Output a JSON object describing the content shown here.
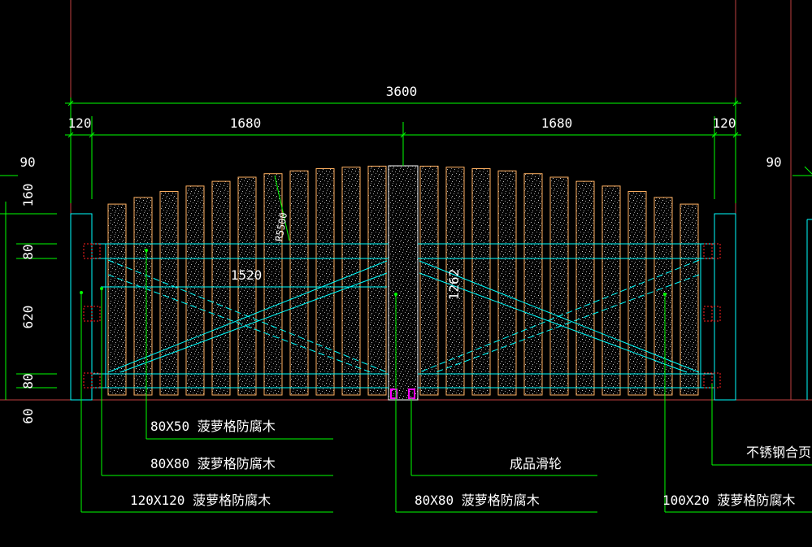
{
  "dimensions": {
    "overall": "3600",
    "left_post": "120",
    "left_leaf": "1680",
    "right_leaf": "1680",
    "right_post": "120",
    "left_offset": "90",
    "right_offset": "90",
    "h_top_arch": "160",
    "h_rail_top": "80",
    "h_middle": "620",
    "h_rail_bottom": "80",
    "h_ground": "60",
    "diag_width": "1520",
    "diag_height": "1262",
    "radius": "R5500"
  },
  "labels": {
    "board_80x50": "80X50 菠萝格防腐木",
    "board_80x80_left": "80X80 菠萝格防腐木",
    "post_120x120": "120X120 菠萝格防腐木",
    "wheel": "成品滑轮",
    "board_80x80_center": "80X80 菠萝格防腐木",
    "hinge": "不锈钢合页",
    "slat_100x20": "100X20 菠萝格防腐木"
  },
  "colors": {
    "background": "#000000",
    "dimension_line": "#00ff00",
    "frame_line": "#00ffff",
    "slat_edge": "#ffb060",
    "speckle": "#c0c0c0",
    "hinge": "#ff2020",
    "wheel": "#ff00ff",
    "axis_red": "#c04040",
    "text": "#ffffff"
  }
}
